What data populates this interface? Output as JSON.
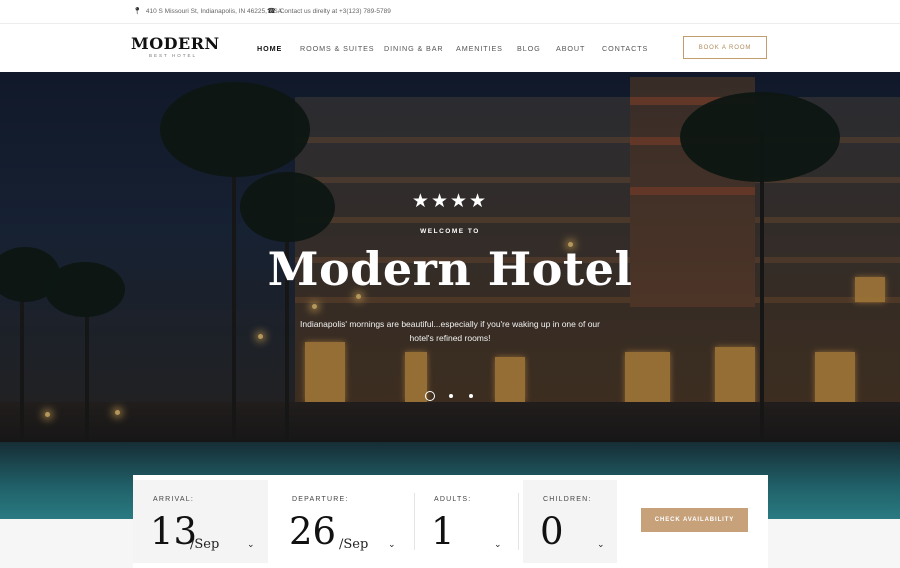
{
  "topbar": {
    "address_icon": "map-pin-icon",
    "address": "410 S Missouri St, Indianapolis, IN 46225, USA",
    "phone_icon": "phone-icon",
    "phone": "Contact us direlty at +3(123) 789-5789"
  },
  "header": {
    "logo_name": "MODERN",
    "logo_tagline": "BEST HOTEL",
    "nav": [
      "HOME",
      "ROOMS & SUITES",
      "DINING & BAR",
      "AMENITIES",
      "BLOG",
      "ABOUT",
      "CONTACTS"
    ],
    "active_nav": "HOME",
    "book_button": "BOOK A ROOM"
  },
  "hero": {
    "stars": "★★★★",
    "rating": 4,
    "welcome": "WELCOME TO",
    "title": "Modern Hotel",
    "subtitle": "Indianapolis' mornings are beautiful...especially if you're waking up in one of our hotel's refined rooms!",
    "slide_count": 3,
    "active_slide": 1
  },
  "booking": {
    "arrival": {
      "label": "ARRIVAL:",
      "day": "13",
      "month": "/Sep"
    },
    "departure": {
      "label": "DEPARTURE:",
      "day": "26",
      "month": "/Sep"
    },
    "adults": {
      "label": "ADULTS:",
      "value": "1"
    },
    "children": {
      "label": "CHILDREN:",
      "value": "0"
    },
    "check_button": "CHECK AVAILABILITY",
    "chevron_icon": "chevron-down-icon"
  },
  "colors": {
    "accent": "#c6a17a",
    "accent_border": "#c29d6f"
  }
}
